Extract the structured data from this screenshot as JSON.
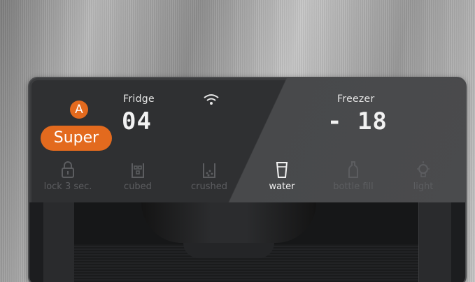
{
  "panel": {
    "fridge_label": "Fridge",
    "fridge_value": "04",
    "freezer_label": "Freezer",
    "freezer_value": "- 18",
    "badge_a": "A",
    "badge_super": "Super",
    "functions": [
      {
        "label": "lock 3 sec.",
        "icon": "lock-icon",
        "active": false
      },
      {
        "label": "cubed",
        "icon": "ice-cubes-icon",
        "active": false
      },
      {
        "label": "crushed",
        "icon": "crushed-ice-icon",
        "active": false
      },
      {
        "label": "water",
        "icon": "glass-icon",
        "active": true
      },
      {
        "label": "bottle fill",
        "icon": "bottle-icon",
        "active": false
      },
      {
        "label": "light",
        "icon": "light-bulb-icon",
        "active": false
      }
    ]
  },
  "colors": {
    "accent": "#e36a1e",
    "panel": "#2f3032",
    "inactive": "#5c5d60",
    "active": "#f2f2f2"
  }
}
